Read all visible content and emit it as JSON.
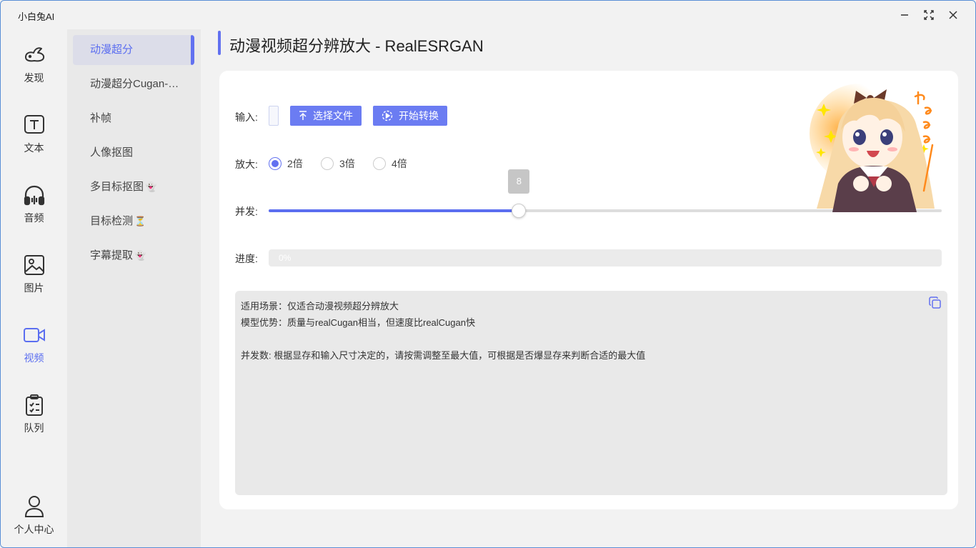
{
  "app": {
    "title": "小白兔AI"
  },
  "window_controls": {
    "minimize": "minimize",
    "maximize": "maximize",
    "close": "close"
  },
  "rail": {
    "items": [
      {
        "label": "发现",
        "icon": "rabbit-icon"
      },
      {
        "label": "文本",
        "icon": "text-icon"
      },
      {
        "label": "音频",
        "icon": "headphones-icon"
      },
      {
        "label": "图片",
        "icon": "image-icon"
      },
      {
        "label": "视频",
        "icon": "video-icon",
        "active": true
      },
      {
        "label": "队列",
        "icon": "clipboard-icon"
      }
    ],
    "user_center": "个人中心"
  },
  "submenu": {
    "items": [
      {
        "label": "动漫超分",
        "emoji": ""
      },
      {
        "label": "动漫超分Cugan-…",
        "emoji": ""
      },
      {
        "label": "补帧",
        "emoji": ""
      },
      {
        "label": "人像抠图",
        "emoji": ""
      },
      {
        "label": "多目标抠图",
        "emoji": "👻"
      },
      {
        "label": "目标检测",
        "emoji": "⏳"
      },
      {
        "label": "字幕提取",
        "emoji": "👻"
      }
    ],
    "active_index": 0
  },
  "page": {
    "title": "动漫视频超分辨放大 - RealESRGAN"
  },
  "form": {
    "input_label": "输入:",
    "select_file": "选择文件",
    "start_convert": "开始转换",
    "scale_label": "放大:",
    "scale_options": [
      "2倍",
      "3倍",
      "4倍"
    ],
    "scale_selected": "2倍",
    "concurrency_label": "并发:",
    "concurrency_value": "8",
    "concurrency_fraction": 0.372,
    "progress_label": "进度:",
    "progress_text": "0%",
    "progress_value": 0
  },
  "info": {
    "lines": [
      "适用场景：仅适合动漫视频超分辨放大",
      "模型优势：质量与realCugan相当，但速度比realCugan快",
      "",
      "并发数: 根据显存和输入尺寸决定的，请按需调整至最大值，可根据是否爆显存来判断合适的最大值"
    ]
  },
  "colors": {
    "accent": "#6271f0",
    "button": "#6b7cf2",
    "submenu_bg": "#e9e9e9",
    "active_item_bg": "#dcdde9"
  }
}
